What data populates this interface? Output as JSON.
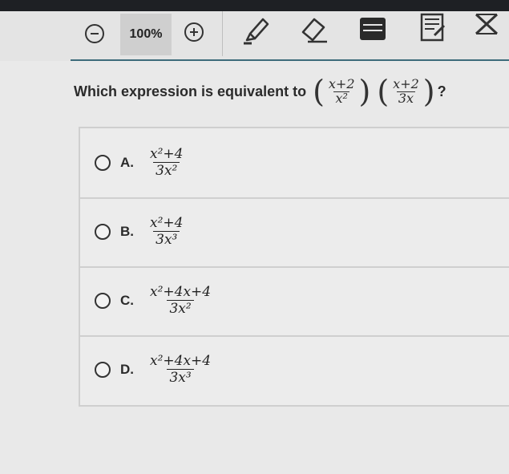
{
  "toolbar": {
    "zoom_level": "100%",
    "icons": [
      "zoom-out-icon",
      "zoom-in-icon",
      "highlighter-icon",
      "eraser-icon",
      "keyboard-icon",
      "notepad-icon",
      "close-icon"
    ]
  },
  "question": {
    "text": "Which expression is equivalent to",
    "factor1": {
      "num": "x+2",
      "den": "x²"
    },
    "factor2": {
      "num": "x+2",
      "den": "3x"
    },
    "end": "?"
  },
  "options": [
    {
      "letter": "A.",
      "num": "x²+4",
      "den": "3x²"
    },
    {
      "letter": "B.",
      "num": "x²+4",
      "den": "3x³"
    },
    {
      "letter": "C.",
      "num": "x²+4x+4",
      "den": "3x²"
    },
    {
      "letter": "D.",
      "num": "x²+4x+4",
      "den": "3x³"
    }
  ]
}
